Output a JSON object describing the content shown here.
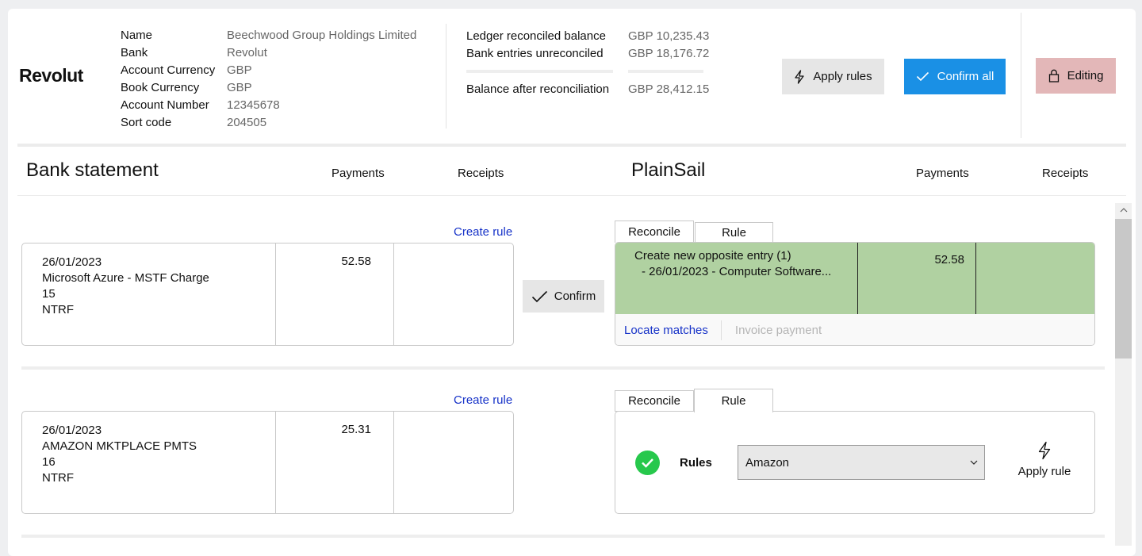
{
  "header": {
    "logo": "Revolut",
    "info": [
      {
        "label": "Name",
        "value": "Beechwood Group Holdings Limited"
      },
      {
        "label": "Bank",
        "value": "Revolut"
      },
      {
        "label": "Account Currency",
        "value": "GBP"
      },
      {
        "label": "Book Currency",
        "value": "GBP"
      },
      {
        "label": "Account Number",
        "value": "12345678"
      },
      {
        "label": "Sort code",
        "value": "204505"
      }
    ],
    "balances": {
      "ledger_label": "Ledger reconciled balance",
      "ledger_value": "GBP 10,235.43",
      "unreconciled_label": "Bank entries unreconciled",
      "unreconciled_value": "GBP 18,176.72",
      "after_label": "Balance after reconciliation",
      "after_value": "GBP 28,412.15"
    },
    "apply_rules_label": "Apply rules",
    "confirm_all_label": "Confirm all",
    "editing_label": "Editing"
  },
  "columns": {
    "bank_title": "Bank statement",
    "bank_payments": "Payments",
    "bank_receipts": "Receipts",
    "ps_title": "PlainSail",
    "ps_payments": "Payments",
    "ps_receipts": "Receipts"
  },
  "rows": [
    {
      "create_rule": "Create rule",
      "date": "26/01/2023",
      "description": "Microsoft Azure - MSTF Charge",
      "ref": "15",
      "type": "NTRF",
      "payment": "52.58",
      "confirm_label": "Confirm",
      "tab_reconcile": "Reconcile",
      "tab_rule": "Rule",
      "match_line1": "Create new opposite entry (1)",
      "match_line2": "- 26/01/2023 - Computer Software...",
      "match_payment": "52.58",
      "locate_matches": "Locate matches",
      "invoice_payment": "Invoice payment"
    },
    {
      "create_rule": "Create rule",
      "date": "26/01/2023",
      "description": "AMAZON MKTPLACE PMTS",
      "ref": "16",
      "type": "NTRF",
      "payment": "25.31",
      "tab_reconcile": "Reconcile",
      "tab_rule": "Rule",
      "rules_label": "Rules",
      "rule_selected": "Amazon",
      "apply_rule_label": "Apply rule"
    }
  ],
  "colors": {
    "accent_blue": "#1a90e5",
    "editing_red": "#e3b7b8",
    "match_green": "#b0d1a1",
    "success_green": "#27c84c",
    "link_blue": "#1632c8"
  }
}
